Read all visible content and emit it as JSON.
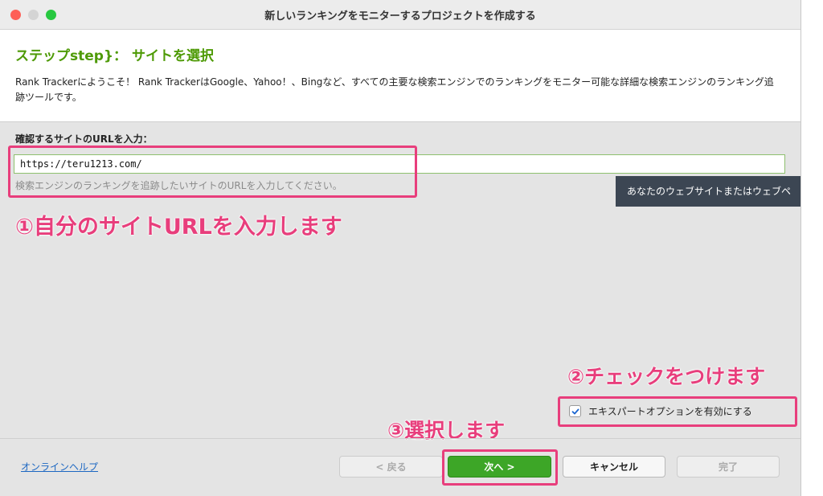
{
  "window": {
    "title": "新しいランキングをモニターするプロジェクトを作成する"
  },
  "header": {
    "step_title": "ステップstep}：  サイトを選択",
    "description": "Rank Trackerにようこそ！ Rank TrackerはGoogle、Yahoo！、Bingなど、すべての主要な検索エンジンでのランキングをモニター可能な詳細な検索エンジンのランキング追跡ツールです。"
  },
  "url_section": {
    "label": "確認するサイトのURLを入力：",
    "value": "https://teru1213.com/",
    "hint": "検索エンジンのランキングを追跡したいサイトのURLを入力してください。"
  },
  "tooltip": "あなたのウェブサイトまたはウェブペ",
  "annotations": {
    "step1": "①自分のサイトURLを入力します",
    "step2": "②チェックをつけます",
    "step3": "③選択します"
  },
  "expert_option": {
    "label": "エキスパートオプションを有効にする",
    "checked": true
  },
  "footer": {
    "help_link": "オンラインヘルプ",
    "back": "< 戻る",
    "next": "次へ >",
    "cancel": "キャンセル",
    "finish": "完了"
  },
  "colors": {
    "accent_green": "#4e9a06",
    "annotation_pink": "#e83e7c",
    "next_button": "#3da627"
  }
}
